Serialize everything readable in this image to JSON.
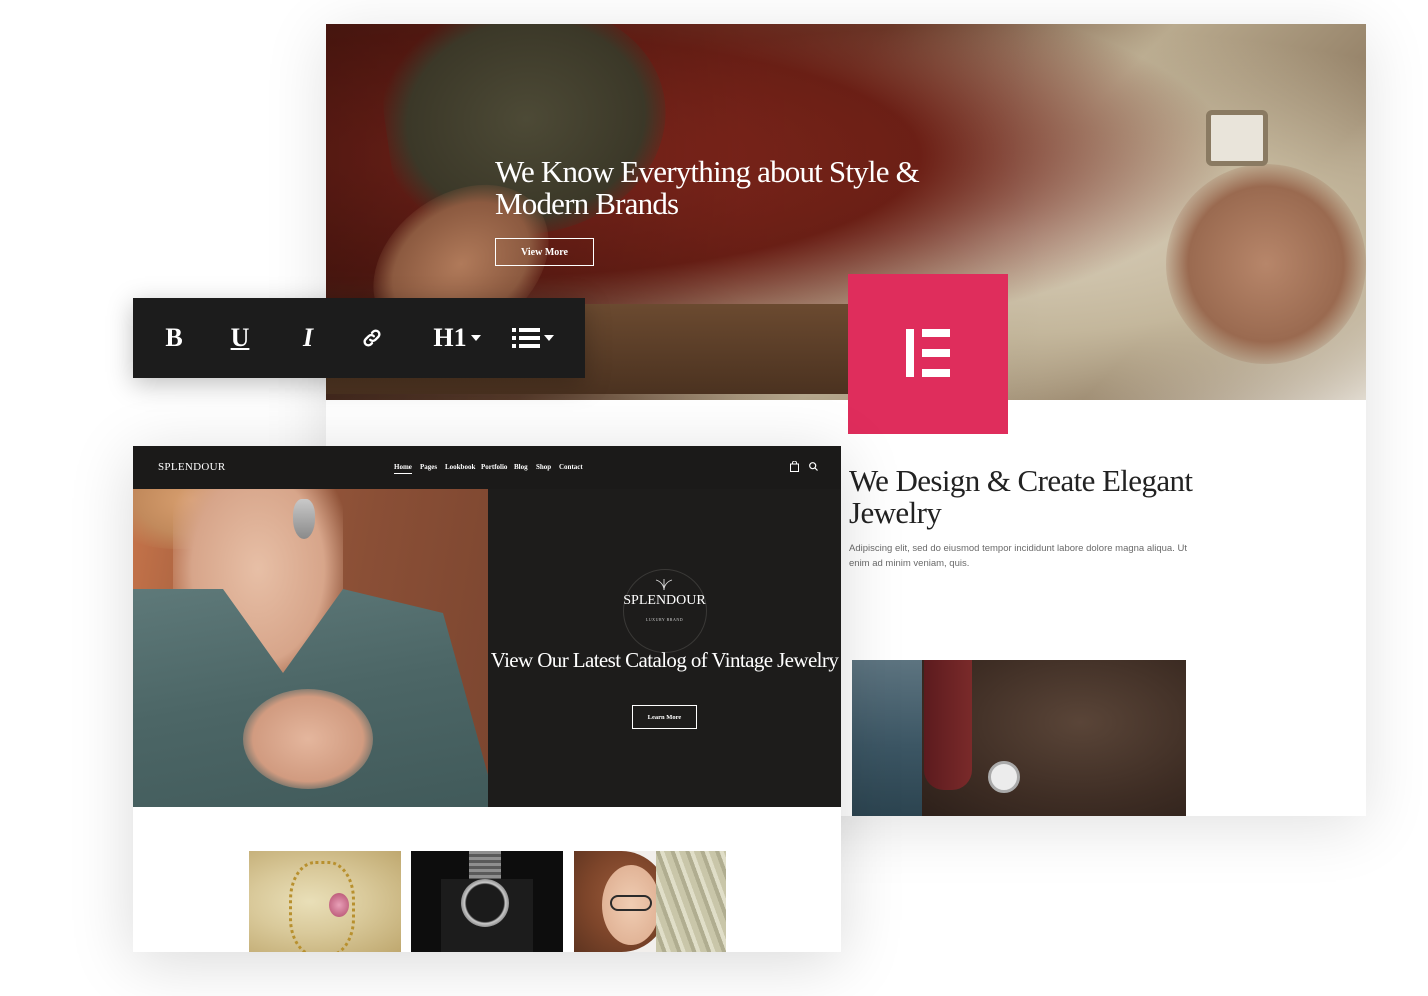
{
  "back_page": {
    "hero_title": "We Know Everything about Style & Modern Brands",
    "hero_button": "View More",
    "section_title": "We Design & Create Elegant Jewelry",
    "section_text": "Adipiscing elit, sed do eiusmod tempor incididunt labore dolore magna aliqua. Ut enim ad minim veniam, quis."
  },
  "elementor": {
    "logo_icon": "elementor-e-icon",
    "brand_color": "#df2d5c"
  },
  "toolbar": {
    "bold_label": "B",
    "underline_label": "U",
    "italic_label": "I",
    "link_icon": "link-icon",
    "heading_label": "H1",
    "list_icon": "list-icon"
  },
  "front_page": {
    "logo": "SPLENDOUR",
    "nav": [
      "Home",
      "Pages",
      "Lookbook",
      "Portfolio",
      "Blog",
      "Shop",
      "Contact"
    ],
    "active_nav": "Home",
    "cart_icon": "shopping-bag-icon",
    "search_icon": "search-icon",
    "brand_name": "SPLENDOUR",
    "brand_sub": "LUXURY BRAND",
    "hero_title": "View Our Latest Catalog of Vintage Jewelry",
    "hero_button": "Learn More"
  }
}
